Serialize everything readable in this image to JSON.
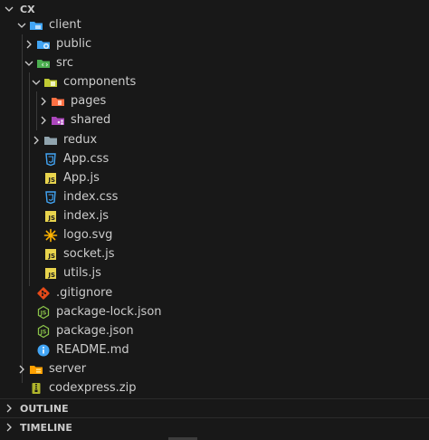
{
  "explorer": {
    "root": {
      "label": "CX",
      "expanded": true
    },
    "tree": [
      {
        "label": "client",
        "icon": "client-folder-icon",
        "expanded": true,
        "depth": 1
      },
      {
        "label": "public",
        "icon": "public-folder-icon",
        "expanded": false,
        "depth": 2
      },
      {
        "label": "src",
        "icon": "src-folder-icon",
        "expanded": true,
        "depth": 2
      },
      {
        "label": "components",
        "icon": "components-folder-icon",
        "expanded": true,
        "depth": 3
      },
      {
        "label": "pages",
        "icon": "pages-folder-icon",
        "expanded": false,
        "depth": 4
      },
      {
        "label": "shared",
        "icon": "shared-folder-icon",
        "expanded": false,
        "depth": 4
      },
      {
        "label": "redux",
        "icon": "folder-icon",
        "expanded": false,
        "depth": 3
      },
      {
        "label": "App.css",
        "icon": "css-file-icon",
        "depth": 3
      },
      {
        "label": "App.js",
        "icon": "js-file-icon",
        "depth": 3
      },
      {
        "label": "index.css",
        "icon": "css-file-icon",
        "depth": 3
      },
      {
        "label": "index.js",
        "icon": "js-file-icon",
        "depth": 3
      },
      {
        "label": "logo.svg",
        "icon": "svg-file-icon",
        "depth": 3
      },
      {
        "label": "socket.js",
        "icon": "js-file-icon",
        "depth": 3
      },
      {
        "label": "utils.js",
        "icon": "js-file-icon",
        "depth": 3
      },
      {
        "label": ".gitignore",
        "icon": "git-file-icon",
        "depth": 2
      },
      {
        "label": "package-lock.json",
        "icon": "node-json-file-icon",
        "depth": 2
      },
      {
        "label": "package.json",
        "icon": "node-json-file-icon",
        "depth": 2
      },
      {
        "label": "README.md",
        "icon": "info-file-icon",
        "depth": 2
      },
      {
        "label": "server",
        "icon": "server-folder-icon",
        "expanded": false,
        "depth": 1
      },
      {
        "label": "codexpress.zip",
        "icon": "zip-file-icon",
        "depth": 1
      }
    ]
  },
  "panels": {
    "outline": "OUTLINE",
    "timeline": "TIMELINE"
  },
  "colors": {
    "background": "#181818",
    "text": "#cccccc",
    "js": "#e8d44d",
    "css": "#42a5f5",
    "git": "#e64a19",
    "node": "#8bc34a",
    "info": "#42a5f5",
    "folder": "#90a4ae",
    "zip": "#afb42b"
  }
}
